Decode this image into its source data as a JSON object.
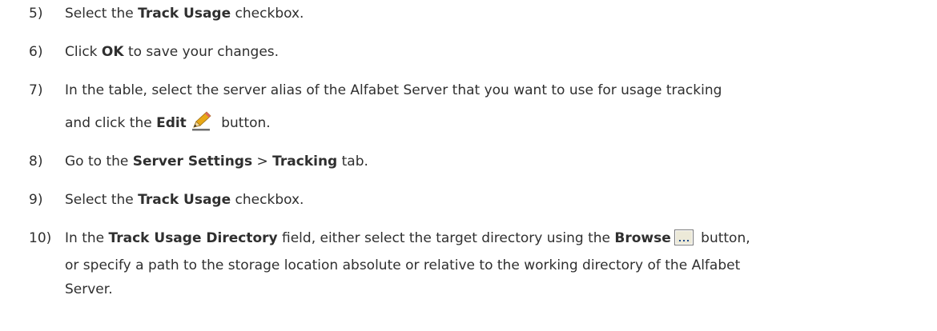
{
  "steps": [
    {
      "number": "5)",
      "parts": [
        "Select the ",
        "Track Usage",
        " checkbox."
      ]
    },
    {
      "number": "6)",
      "parts": [
        "Click ",
        "OK",
        " to save your changes."
      ]
    },
    {
      "number": "7)",
      "line1": "In the table, select the server alias of the Alfabet Server that you want to use for usage tracking",
      "parts": [
        "and click the ",
        "Edit",
        " button."
      ]
    },
    {
      "number": "8)",
      "parts": [
        "Go to the ",
        "Server Settings",
        " > ",
        "Tracking",
        " tab."
      ]
    },
    {
      "number": "9)",
      "parts": [
        "Select the ",
        "Track Usage",
        " checkbox."
      ]
    },
    {
      "number": "10)",
      "parts": [
        "In the ",
        "Track Usage Directory",
        " field, either select the target directory using the ",
        "Browse",
        " button,"
      ],
      "line2": "or specify a path to the storage location absolute or relative to the working directory of the Alfabet",
      "line3": "Server."
    }
  ],
  "icons": {
    "edit": "pencil-icon",
    "browse": "browse-ellipsis-icon"
  }
}
